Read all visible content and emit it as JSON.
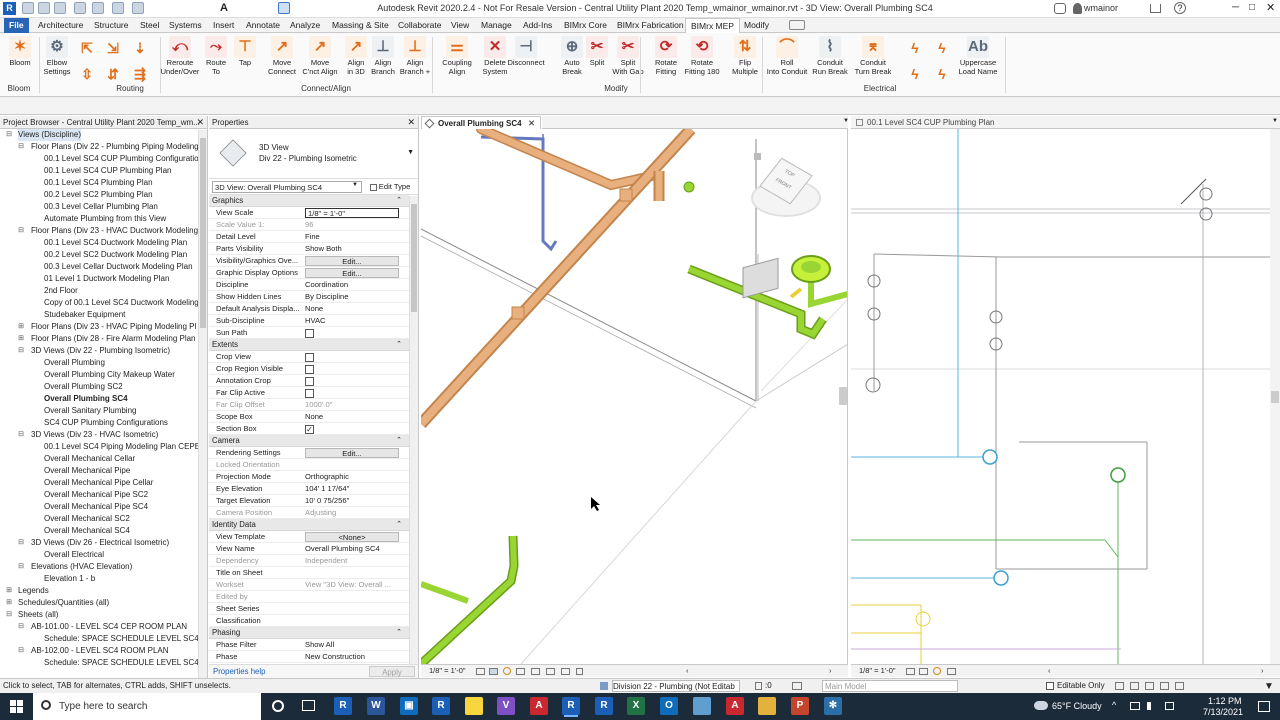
{
  "title_bar": {
    "title": "Autodesk Revit 2020.2.4 - Not For Resale Version - Central Utility Plant 2020 Temp_wmainor_wmainor.rvt - 3D View: Overall Plumbing SC4",
    "user": "wmainor"
  },
  "menu_tabs": [
    "File",
    "Architecture",
    "Structure",
    "Steel",
    "Systems",
    "Insert",
    "Annotate",
    "Analyze",
    "Massing & Site",
    "Collaborate",
    "View",
    "Manage",
    "Add-Ins",
    "BIMrx Core",
    "BIMrx Fabrication",
    "BIMrx MEP",
    "Modify"
  ],
  "ribbon": {
    "tools": [
      {
        "label": "Bloom",
        "icon": "bloom-icon"
      },
      {
        "label": "Elbow\nSettings",
        "icon": "elbow-settings-icon"
      },
      {
        "label": "Reroute\nUnder/Over",
        "icon": "reroute-icon"
      },
      {
        "label": "Route\nTo",
        "icon": "route-to-icon"
      },
      {
        "label": "Tap",
        "icon": "tap-icon"
      },
      {
        "label": "Move\nConnect",
        "icon": "move-connect-icon"
      },
      {
        "label": "Move\nC'nct Align",
        "icon": "move-connect-align-icon"
      },
      {
        "label": "Align\nin 3D",
        "icon": "align-3d-icon"
      },
      {
        "label": "Align\nBranch",
        "icon": "align-branch-icon"
      },
      {
        "label": "Align\nBranch +",
        "icon": "align-branch-plus-icon"
      },
      {
        "label": "Coupling\nAlign",
        "icon": "coupling-align-icon"
      },
      {
        "label": "Delete\nSystem",
        "icon": "delete-system-icon"
      },
      {
        "label": "Disconnect",
        "icon": "disconnect-icon"
      },
      {
        "label": "Auto\nBreak",
        "icon": "auto-break-icon"
      },
      {
        "label": "Split",
        "icon": "split-icon"
      },
      {
        "label": "Split\nWith Gap",
        "icon": "split-gap-icon"
      },
      {
        "label": "Rotate\nFitting",
        "icon": "rotate-fitting-icon"
      },
      {
        "label": "Rotate\nFitting 180",
        "icon": "rotate-fitting-180-icon"
      },
      {
        "label": "Flip\nMultiple",
        "icon": "flip-multiple-icon"
      },
      {
        "label": "Roll\nInto Conduit",
        "icon": "roll-conduit-icon"
      },
      {
        "label": "Conduit\nRun Break",
        "icon": "conduit-run-break-icon"
      },
      {
        "label": "Conduit\nTurn Break",
        "icon": "conduit-turn-break-icon"
      },
      {
        "label": "Uppercase\nLoad Name",
        "icon": "uppercase-icon"
      }
    ],
    "groups": [
      "Bloom",
      "Routing",
      "Connect/Align",
      "Modify",
      "Electrical"
    ]
  },
  "project_browser": {
    "title": "Project Browser - Central Utility Plant 2020 Temp_wm...",
    "items": [
      {
        "label": "Views (Discipline)",
        "level": 0,
        "tw": "⊟"
      },
      {
        "label": "Floor Plans (Div 22 - Plumbing Piping Modeling)",
        "level": 1,
        "tw": "⊟"
      },
      {
        "label": "00.1 Level SC4 CUP Plumbing Configuration",
        "level": 2
      },
      {
        "label": "00.1 Level SC4 CUP Plumbing Plan",
        "level": 2
      },
      {
        "label": "00.1 Level SC4 Plumbing Plan",
        "level": 2
      },
      {
        "label": "00.2 Level SC2 Plumbing Plan",
        "level": 2
      },
      {
        "label": "00.3 Level Cellar Plumbing Plan",
        "level": 2
      },
      {
        "label": "Automate Plumbing from this View",
        "level": 2
      },
      {
        "label": "Floor Plans (Div 23 - HVAC Ductwork Modeling)",
        "level": 1,
        "tw": "⊟"
      },
      {
        "label": "00.1 Level SC4 Ductwork Modeling Plan",
        "level": 2
      },
      {
        "label": "00.2 Level SC2 Ductwork Modeling Plan",
        "level": 2
      },
      {
        "label": "00.3 Level Cellar Ductwork Modeling Plan",
        "level": 2
      },
      {
        "label": "01    Level 1 Ductwork Modeling Plan",
        "level": 2
      },
      {
        "label": "2nd Floor",
        "level": 2
      },
      {
        "label": "Copy of 00.1 Level SC4 Ductwork Modeling",
        "level": 2
      },
      {
        "label": "Studebaker Equipment",
        "level": 2
      },
      {
        "label": "Floor Plans (Div 23 - HVAC Piping Modeling Pl",
        "level": 1,
        "tw": "⊞"
      },
      {
        "label": "Floor Plans (Div 28 - Fire Alarm Modeling Plan",
        "level": 1,
        "tw": "⊞"
      },
      {
        "label": "3D Views (Div 22 - Plumbing Isometric)",
        "level": 1,
        "tw": "⊟"
      },
      {
        "label": "Overall Plumbing",
        "level": 2
      },
      {
        "label": "Overall Plumbing City Makeup Water",
        "level": 2
      },
      {
        "label": "Overall Plumbing SC2",
        "level": 2
      },
      {
        "label": "Overall Plumbing SC4",
        "level": 2,
        "sel": true
      },
      {
        "label": "Overall Sanitary Plumbing",
        "level": 2
      },
      {
        "label": "SC4 CUP Plumbing Configurations",
        "level": 2
      },
      {
        "label": "3D Views (Div 23 - HVAC Isometric)",
        "level": 1,
        "tw": "⊟"
      },
      {
        "label": "00.1 Level SC4 Piping Modeling Plan CEPE",
        "level": 2
      },
      {
        "label": "Overall Mechanical Cellar",
        "level": 2
      },
      {
        "label": "Overall Mechanical Pipe",
        "level": 2
      },
      {
        "label": "Overall Mechanical Pipe Cellar",
        "level": 2
      },
      {
        "label": "Overall Mechanical Pipe SC2",
        "level": 2
      },
      {
        "label": "Overall Mechanical Pipe SC4",
        "level": 2
      },
      {
        "label": "Overall Mechanical SC2",
        "level": 2
      },
      {
        "label": "Overall Mechanical SC4",
        "level": 2
      },
      {
        "label": "3D Views (Div 26 - Electrical Isometric)",
        "level": 1,
        "tw": "⊟"
      },
      {
        "label": "Overall Electrical",
        "level": 2
      },
      {
        "label": "Elevations (HVAC Elevation)",
        "level": 1,
        "tw": "⊟"
      },
      {
        "label": "Elevation 1 - b",
        "level": 2
      },
      {
        "label": "Legends",
        "level": 0,
        "tw": "⊞"
      },
      {
        "label": "Schedules/Quantities (all)",
        "level": 0,
        "tw": "⊞"
      },
      {
        "label": "Sheets (all)",
        "level": 0,
        "tw": "⊟"
      },
      {
        "label": "AB-101.00 - LEVEL SC4 CEP ROOM PLAN",
        "level": 1,
        "tw": "⊟"
      },
      {
        "label": "Schedule: SPACE SCHEDULE LEVEL SC4 C",
        "level": 2
      },
      {
        "label": "AB-102.00 - LEVEL SC4 ROOM PLAN",
        "level": 1,
        "tw": "⊟"
      },
      {
        "label": "Schedule: SPACE SCHEDULE LEVEL SC4",
        "level": 2
      }
    ]
  },
  "properties": {
    "title": "Properties",
    "type_name": "3D View",
    "type_sub": "Div 22 - Plumbing Isometric",
    "selector": "3D View: Overall Plumbing SC4",
    "edit_type": "Edit Type",
    "sections": [
      {
        "name": "Graphics",
        "rows": [
          {
            "k": "View Scale",
            "v": "1/8\" = 1'-0\"",
            "style": "box"
          },
          {
            "k": "Scale Value    1:",
            "v": "96",
            "dim": true
          },
          {
            "k": "Detail Level",
            "v": "Fine"
          },
          {
            "k": "Parts Visibility",
            "v": "Show Both"
          },
          {
            "k": "Visibility/Graphics Ove...",
            "v": "Edit...",
            "style": "btn"
          },
          {
            "k": "Graphic Display Options",
            "v": "Edit...",
            "style": "btn"
          },
          {
            "k": "Discipline",
            "v": "Coordination"
          },
          {
            "k": "Show Hidden Lines",
            "v": "By Discipline"
          },
          {
            "k": "Default Analysis Displa...",
            "v": "None"
          },
          {
            "k": "Sub-Discipline",
            "v": "HVAC"
          },
          {
            "k": "Sun Path",
            "cb": false
          }
        ]
      },
      {
        "name": "Extents",
        "rows": [
          {
            "k": "Crop View",
            "cb": false
          },
          {
            "k": "Crop Region Visible",
            "cb": false
          },
          {
            "k": "Annotation Crop",
            "cb": false
          },
          {
            "k": "Far Clip Active",
            "cb": false
          },
          {
            "k": "Far Clip Offset",
            "v": "1000'  0\"",
            "dim": true
          },
          {
            "k": "Scope Box",
            "v": "None"
          },
          {
            "k": "Section Box",
            "cb": true
          }
        ]
      },
      {
        "name": "Camera",
        "rows": [
          {
            "k": "Rendering Settings",
            "v": "Edit...",
            "style": "btn"
          },
          {
            "k": "Locked Orientation",
            "v": "",
            "dim": true
          },
          {
            "k": "Projection Mode",
            "v": "Orthographic"
          },
          {
            "k": "Eye Elevation",
            "v": "104'  1 17/64\""
          },
          {
            "k": "Target Elevation",
            "v": "10'  0 75/256\""
          },
          {
            "k": "Camera Position",
            "v": "Adjusting",
            "dim": true
          }
        ]
      },
      {
        "name": "Identity Data",
        "rows": [
          {
            "k": "View Template",
            "v": "<None>",
            "style": "btn"
          },
          {
            "k": "View Name",
            "v": "Overall Plumbing SC4"
          },
          {
            "k": "Dependency",
            "v": "Independent",
            "dim": true
          },
          {
            "k": "Title on Sheet",
            "v": ""
          },
          {
            "k": "Workset",
            "v": "View \"3D View: Overall ...",
            "dim": true
          },
          {
            "k": "Edited by",
            "v": "",
            "dim": true
          },
          {
            "k": "Sheet Series",
            "v": ""
          },
          {
            "k": "Classification",
            "v": ""
          }
        ]
      },
      {
        "name": "Phasing",
        "rows": [
          {
            "k": "Phase Filter",
            "v": "Show All"
          },
          {
            "k": "Phase",
            "v": "New Construction"
          }
        ]
      }
    ],
    "help": "Properties help",
    "apply": "Apply"
  },
  "view_tabs": {
    "left": "Overall Plumbing SC4",
    "right": "00.1 Level SC4 CUP Plumbing Plan"
  },
  "view_controls": {
    "left_scale": "1/8\" = 1'-0\"",
    "right_scale": "1/8\" = 1'-0\""
  },
  "viewcube": {
    "top": "TOP",
    "front": "FRONT"
  },
  "status_bar": {
    "hint": "Click to select, TAB for alternates, CTRL adds, SHIFT unselects.",
    "workset": "Division 22 - Plumbing (Not Editab",
    "sel_count": ":0",
    "model": "Main Model",
    "editable_only": "Editable Only"
  },
  "taskbar": {
    "search": "Type here to search",
    "weather": "65°F  Cloudy",
    "time": "1:12 PM",
    "date": "7/13/2021"
  },
  "colors": {
    "accent": "#2a64b4",
    "pipe_copper": "#e7b07e",
    "pipe_green": "#9ad633",
    "pipe_blue": "#6678c0"
  }
}
